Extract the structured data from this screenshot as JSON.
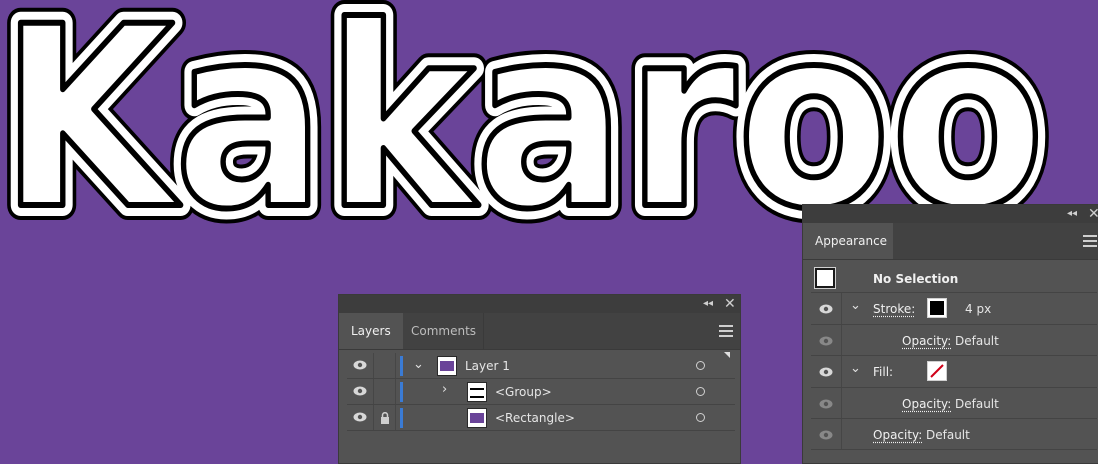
{
  "artwork": {
    "text": "Kakaroo",
    "canvas_color": "#6a4499"
  },
  "layers_panel": {
    "tabs": [
      {
        "label": "Layers"
      },
      {
        "label": "Comments"
      }
    ],
    "rows": [
      {
        "name": "Layer 1",
        "expanded": true,
        "locked": false
      },
      {
        "name": "<Group>",
        "expanded": false,
        "locked": false
      },
      {
        "name": "<Rectangle>",
        "locked": true
      }
    ]
  },
  "appearance_panel": {
    "tab": "Appearance",
    "selection": "No Selection",
    "stroke": {
      "label": "Stroke:",
      "value": "4 px",
      "color": "#000000"
    },
    "stroke_opacity": {
      "label": "Opacity:",
      "value": "Default"
    },
    "fill": {
      "label": "Fill:",
      "state": "none"
    },
    "fill_opacity": {
      "label": "Opacity:",
      "value": "Default"
    },
    "opacity": {
      "label": "Opacity:",
      "value": "Default"
    }
  },
  "icons": {
    "eye": "eye-icon",
    "lock": "lock-icon",
    "collapse": "collapse-panel-icon",
    "close": "close-icon",
    "menu": "panel-menu-icon",
    "chevron": "chevron-icon",
    "target": "target-circle-icon"
  }
}
